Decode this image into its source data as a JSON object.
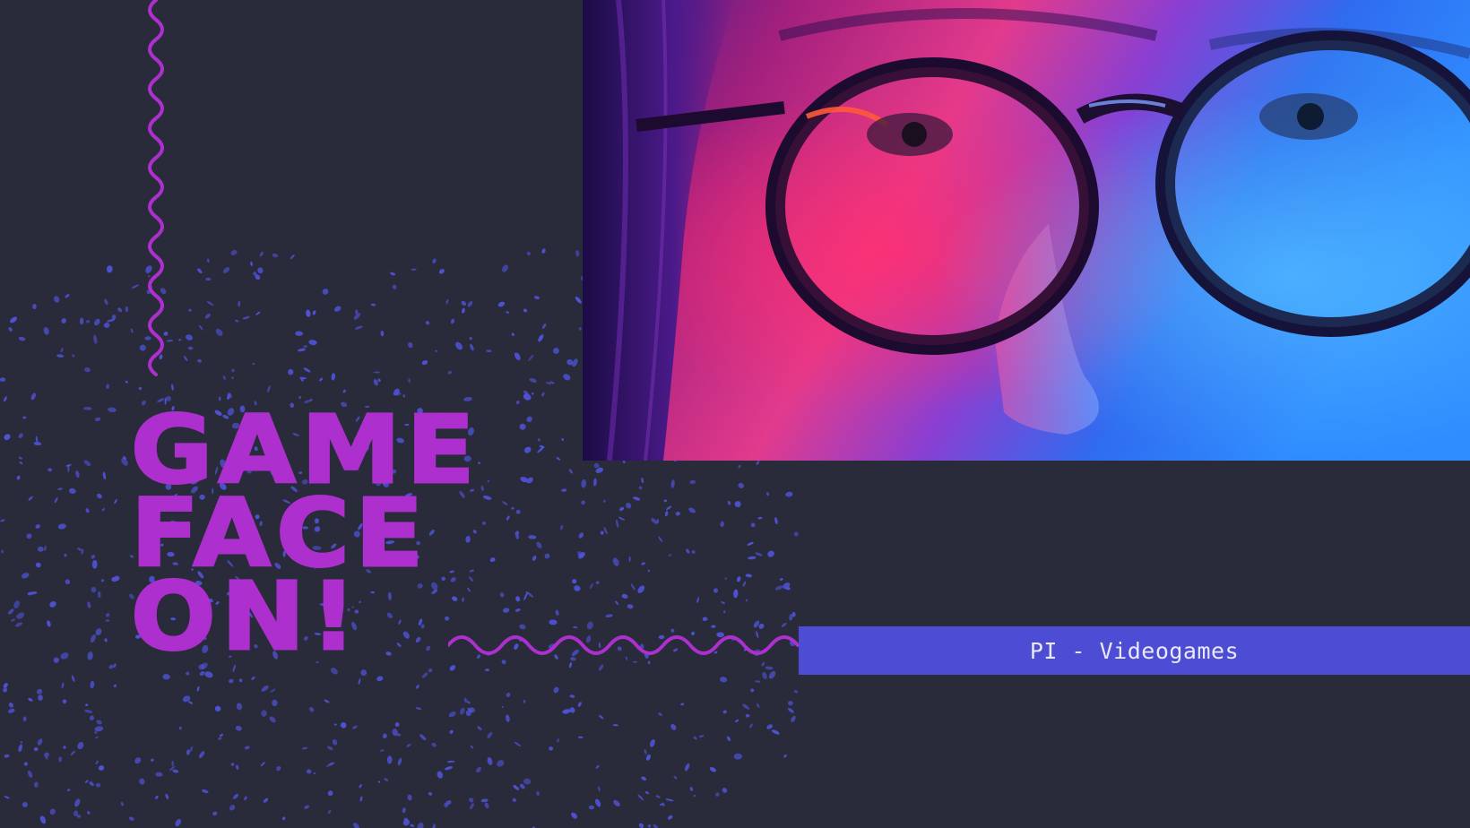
{
  "slide": {
    "headline": {
      "line1": "GAME",
      "line2": "FACE",
      "line3": "ON!"
    },
    "subtitle": "PI - Videogames"
  },
  "colors": {
    "background": "#292b3b",
    "accent_purple": "#ad2fce",
    "accent_blue": "#4c4cd5",
    "speckle": "#4f52d6"
  },
  "image": {
    "subject": "close-up of a person wearing round glasses under pink and blue neon light"
  }
}
